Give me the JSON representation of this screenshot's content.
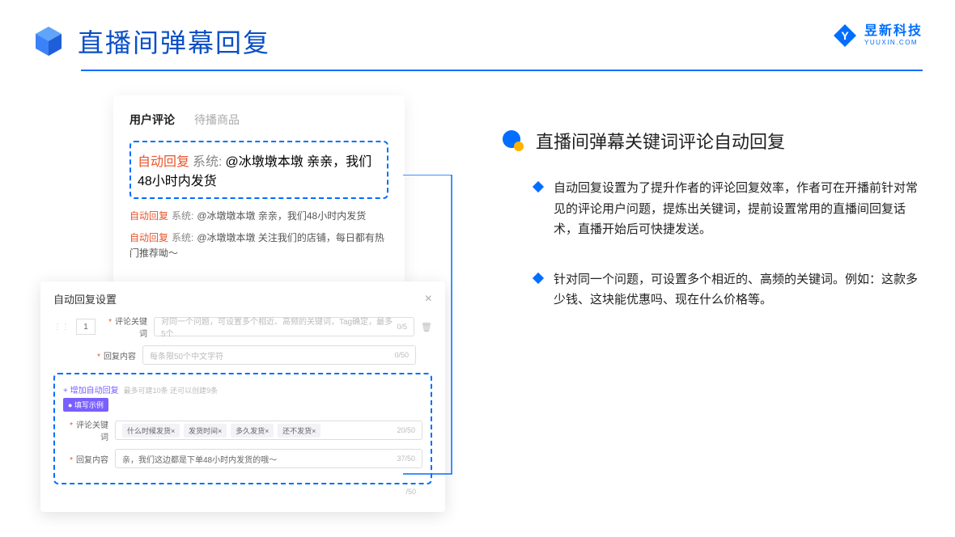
{
  "header": {
    "title": "直播间弹幕回复"
  },
  "brand": {
    "cn": "昱新科技",
    "en": "YUUXIN.COM"
  },
  "card_top": {
    "tabs": {
      "active": "用户评论",
      "inactive": "待播商品"
    },
    "highlight": {
      "tag": "自动回复",
      "sys": "系统:",
      "text": "@冰墩墩本墩 亲亲，我们48小时内发货"
    },
    "lines": [
      {
        "tag": "自动回复",
        "sys": "系统:",
        "text": "@冰墩墩本墩 亲亲，我们48小时内发货"
      },
      {
        "tag": "自动回复",
        "sys": "系统:",
        "text": "@冰墩墩本墩 关注我们的店铺，每日都有热门推荐呦～"
      }
    ]
  },
  "card_bot": {
    "title": "自动回复设置",
    "num": "1",
    "row1": {
      "label": "评论关键词",
      "ph": "对同一个问题，可设置多个相近、高频的关键词，Tag确定，最多5个",
      "cnt": "0/5"
    },
    "row2": {
      "label": "回复内容",
      "ph": "每条限50个中文字符",
      "cnt": "0/50"
    },
    "add": {
      "link": "+ 增加自动回复",
      "hint": "最多可建10条 还可以创建9条"
    },
    "ex_badge": "● 填写示例",
    "ex1": {
      "label": "评论关键词",
      "tags": [
        "什么时候发货×",
        "发货时间×",
        "多久发货×",
        "还不发货×"
      ],
      "cnt": "20/50"
    },
    "ex2": {
      "label": "回复内容",
      "text": "亲，我们这边都是下单48小时内发货的哦～",
      "cnt": "37/50"
    },
    "tail_cnt": "/50"
  },
  "section": {
    "title": "直播间弹幕关键词评论自动回复",
    "bullets": [
      "自动回复设置为了提升作者的评论回复效率，作者可在开播前针对常见的评论用户问题，提炼出关键词，提前设置常用的直播间回复话术，直播开始后可快捷发送。",
      "针对同一个问题，可设置多个相近的、高频的关键词。例如：这款多少钱、这块能优惠吗、现在什么价格等。"
    ]
  }
}
